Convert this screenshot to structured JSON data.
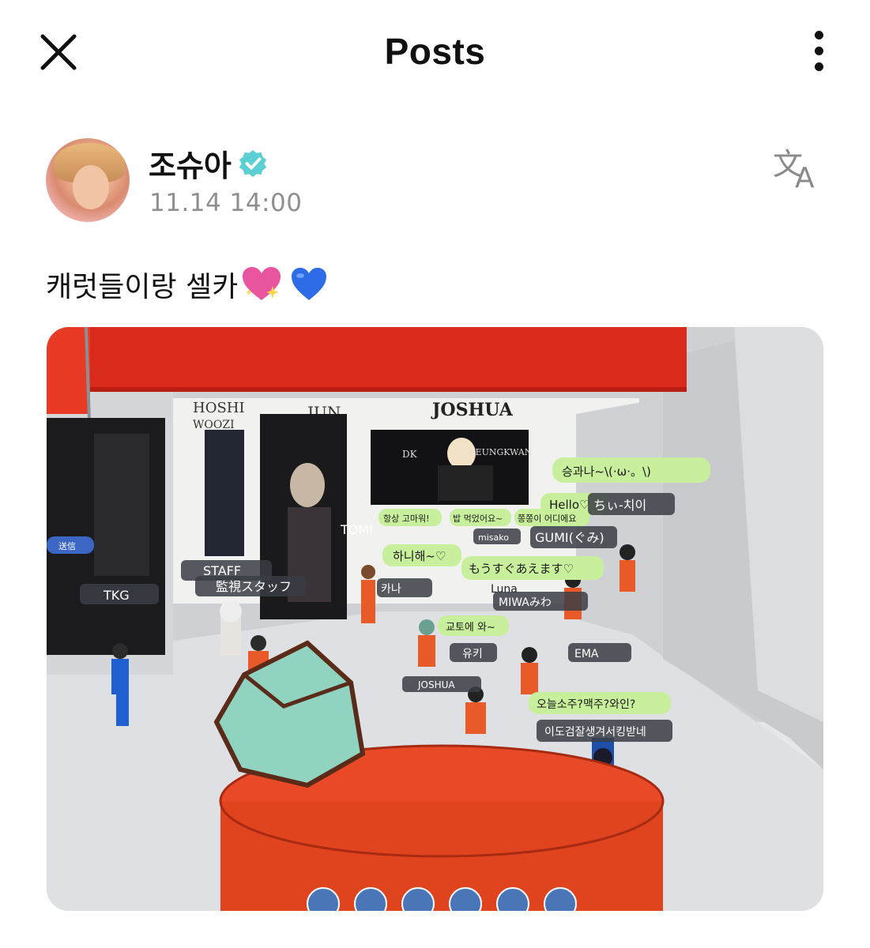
{
  "header": {
    "title": "Posts",
    "close_icon": "close-icon",
    "more_icon": "more-vertical-icon"
  },
  "post": {
    "author": {
      "name": "조슈아",
      "verified": true,
      "verified_color": "#5ccfd4"
    },
    "timestamp": "11.14 14:00",
    "translate_icon": "translate-icon",
    "caption": "캐럿들이랑 셀카",
    "caption_emojis": [
      "sparkling-heart-emoji",
      "blue-heart-emoji"
    ],
    "photo": {
      "banners": [
        "JUN",
        "JOSHUA",
        "DK",
        "SEUNGKWAN",
        "HOSHI",
        "WOOZI"
      ],
      "chat_bubbles": [
        "승과나~\\(·ω·。\\)",
        "Hello♡",
        "항상 고마워!",
        "밥 먹었어요~",
        "쫑쫑이 어디에요",
        "하니해~♡",
        "もうすぐあえます♡",
        "교토에 와~",
        "오늘소주?맥주?와인?",
        "이도검잘생겨서킹받네"
      ],
      "name_tags": [
        "ちぃ-치이",
        "TOMI",
        "misako",
        "GUMI(ぐみ)",
        "STAFF",
        "監視スタッフ",
        "TKG",
        "카나",
        "Luna",
        "MIWAみわ",
        "유키",
        "EMA",
        "JOSHUA",
        "送信"
      ]
    }
  }
}
